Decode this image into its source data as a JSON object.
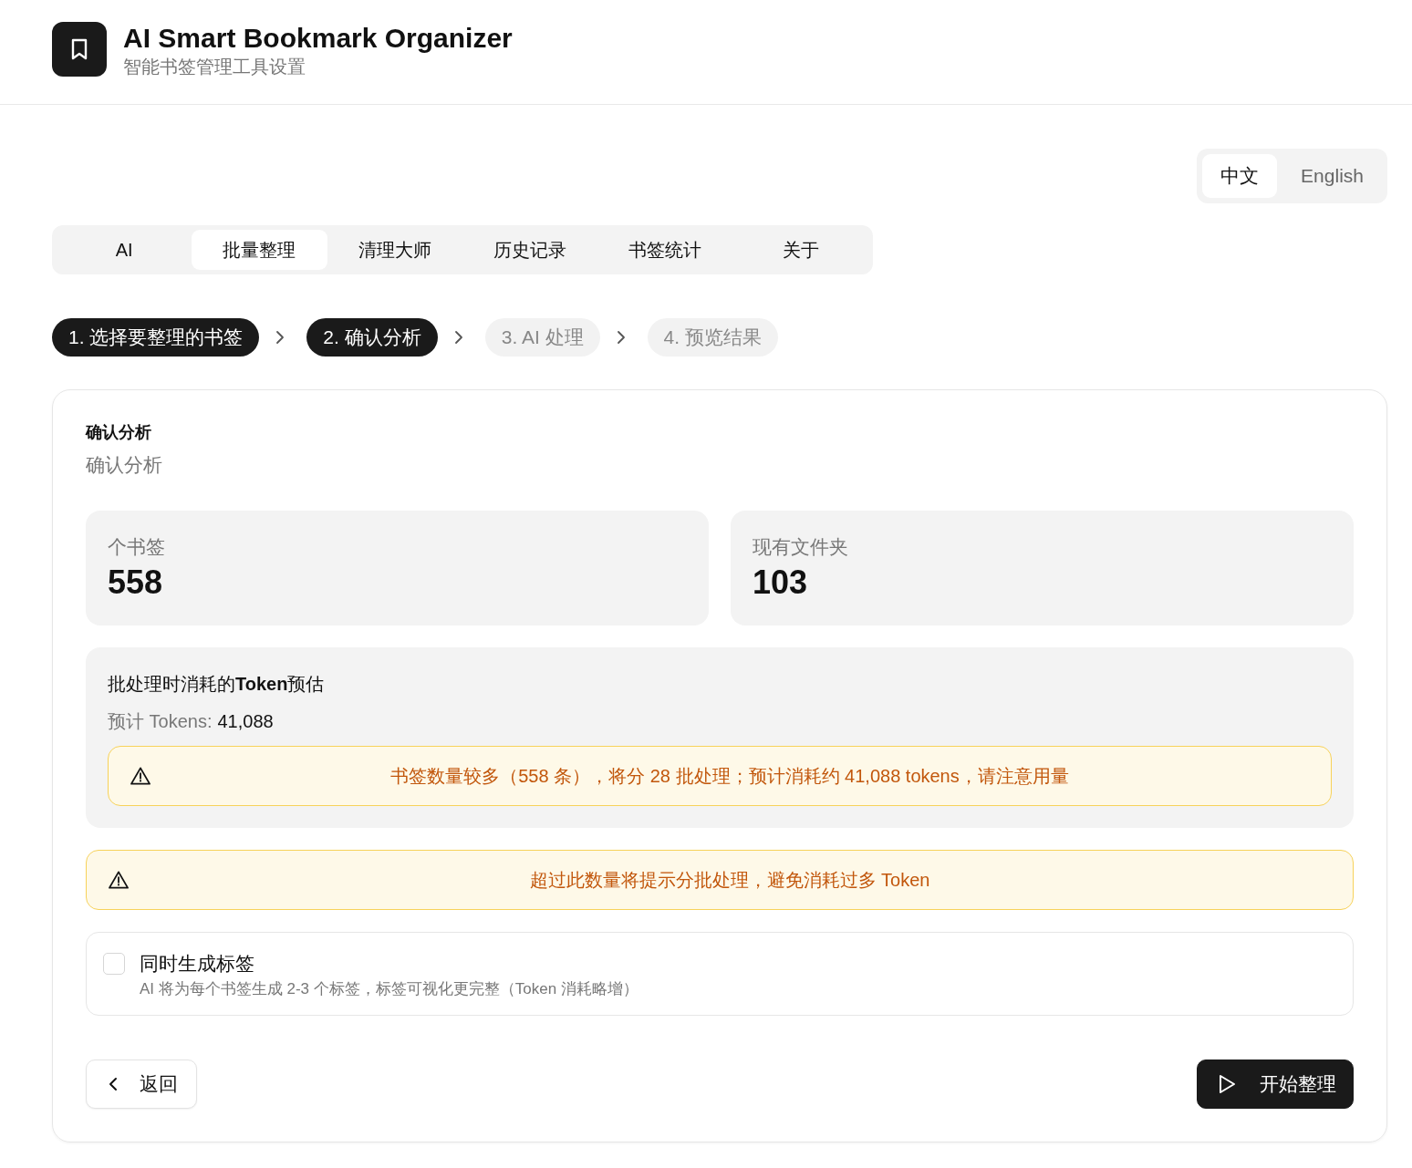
{
  "header": {
    "title": "AI Smart Bookmark Organizer",
    "subtitle": "智能书签管理工具设置"
  },
  "language": [
    {
      "label": "中文",
      "selected": true
    },
    {
      "label": "English",
      "selected": false
    }
  ],
  "tabs": [
    {
      "label": "AI",
      "selected": false
    },
    {
      "label": "批量整理",
      "selected": true
    },
    {
      "label": "清理大师",
      "selected": false
    },
    {
      "label": "历史记录",
      "selected": false
    },
    {
      "label": "书签统计",
      "selected": false
    },
    {
      "label": "关于",
      "selected": false
    }
  ],
  "steps": [
    {
      "label": "1. 选择要整理的书签",
      "reached": true
    },
    {
      "label": "2. 确认分析",
      "reached": true
    },
    {
      "label": "3. AI 处理",
      "reached": false
    },
    {
      "label": "4. 预览结果",
      "reached": false
    }
  ],
  "card": {
    "title": "确认分析",
    "subtitle": "确认分析",
    "stats": [
      {
        "label": "个书签",
        "value": "558"
      },
      {
        "label": "现有文件夹",
        "value": "103"
      }
    ],
    "token_estimate": {
      "title": "批处理时消耗的**Token**预估",
      "label": "预计 Tokens:",
      "value": "41,088",
      "warning": "书签数量较多（558 条），将分 28 批处理；预计消耗约 41,088 tokens，请注意用量"
    },
    "notice": "超过此数量将提示分批处理，避免消耗过多 Token",
    "option": {
      "label": "同时生成标签",
      "description": "AI 将为每个书签生成 2-3 个标签，标签可视化更完整（Token 消耗略增）",
      "checked": false
    },
    "buttons": [
      {
        "kind": "back",
        "label": "返回"
      },
      {
        "kind": "start",
        "label": "开始整理"
      }
    ]
  }
}
